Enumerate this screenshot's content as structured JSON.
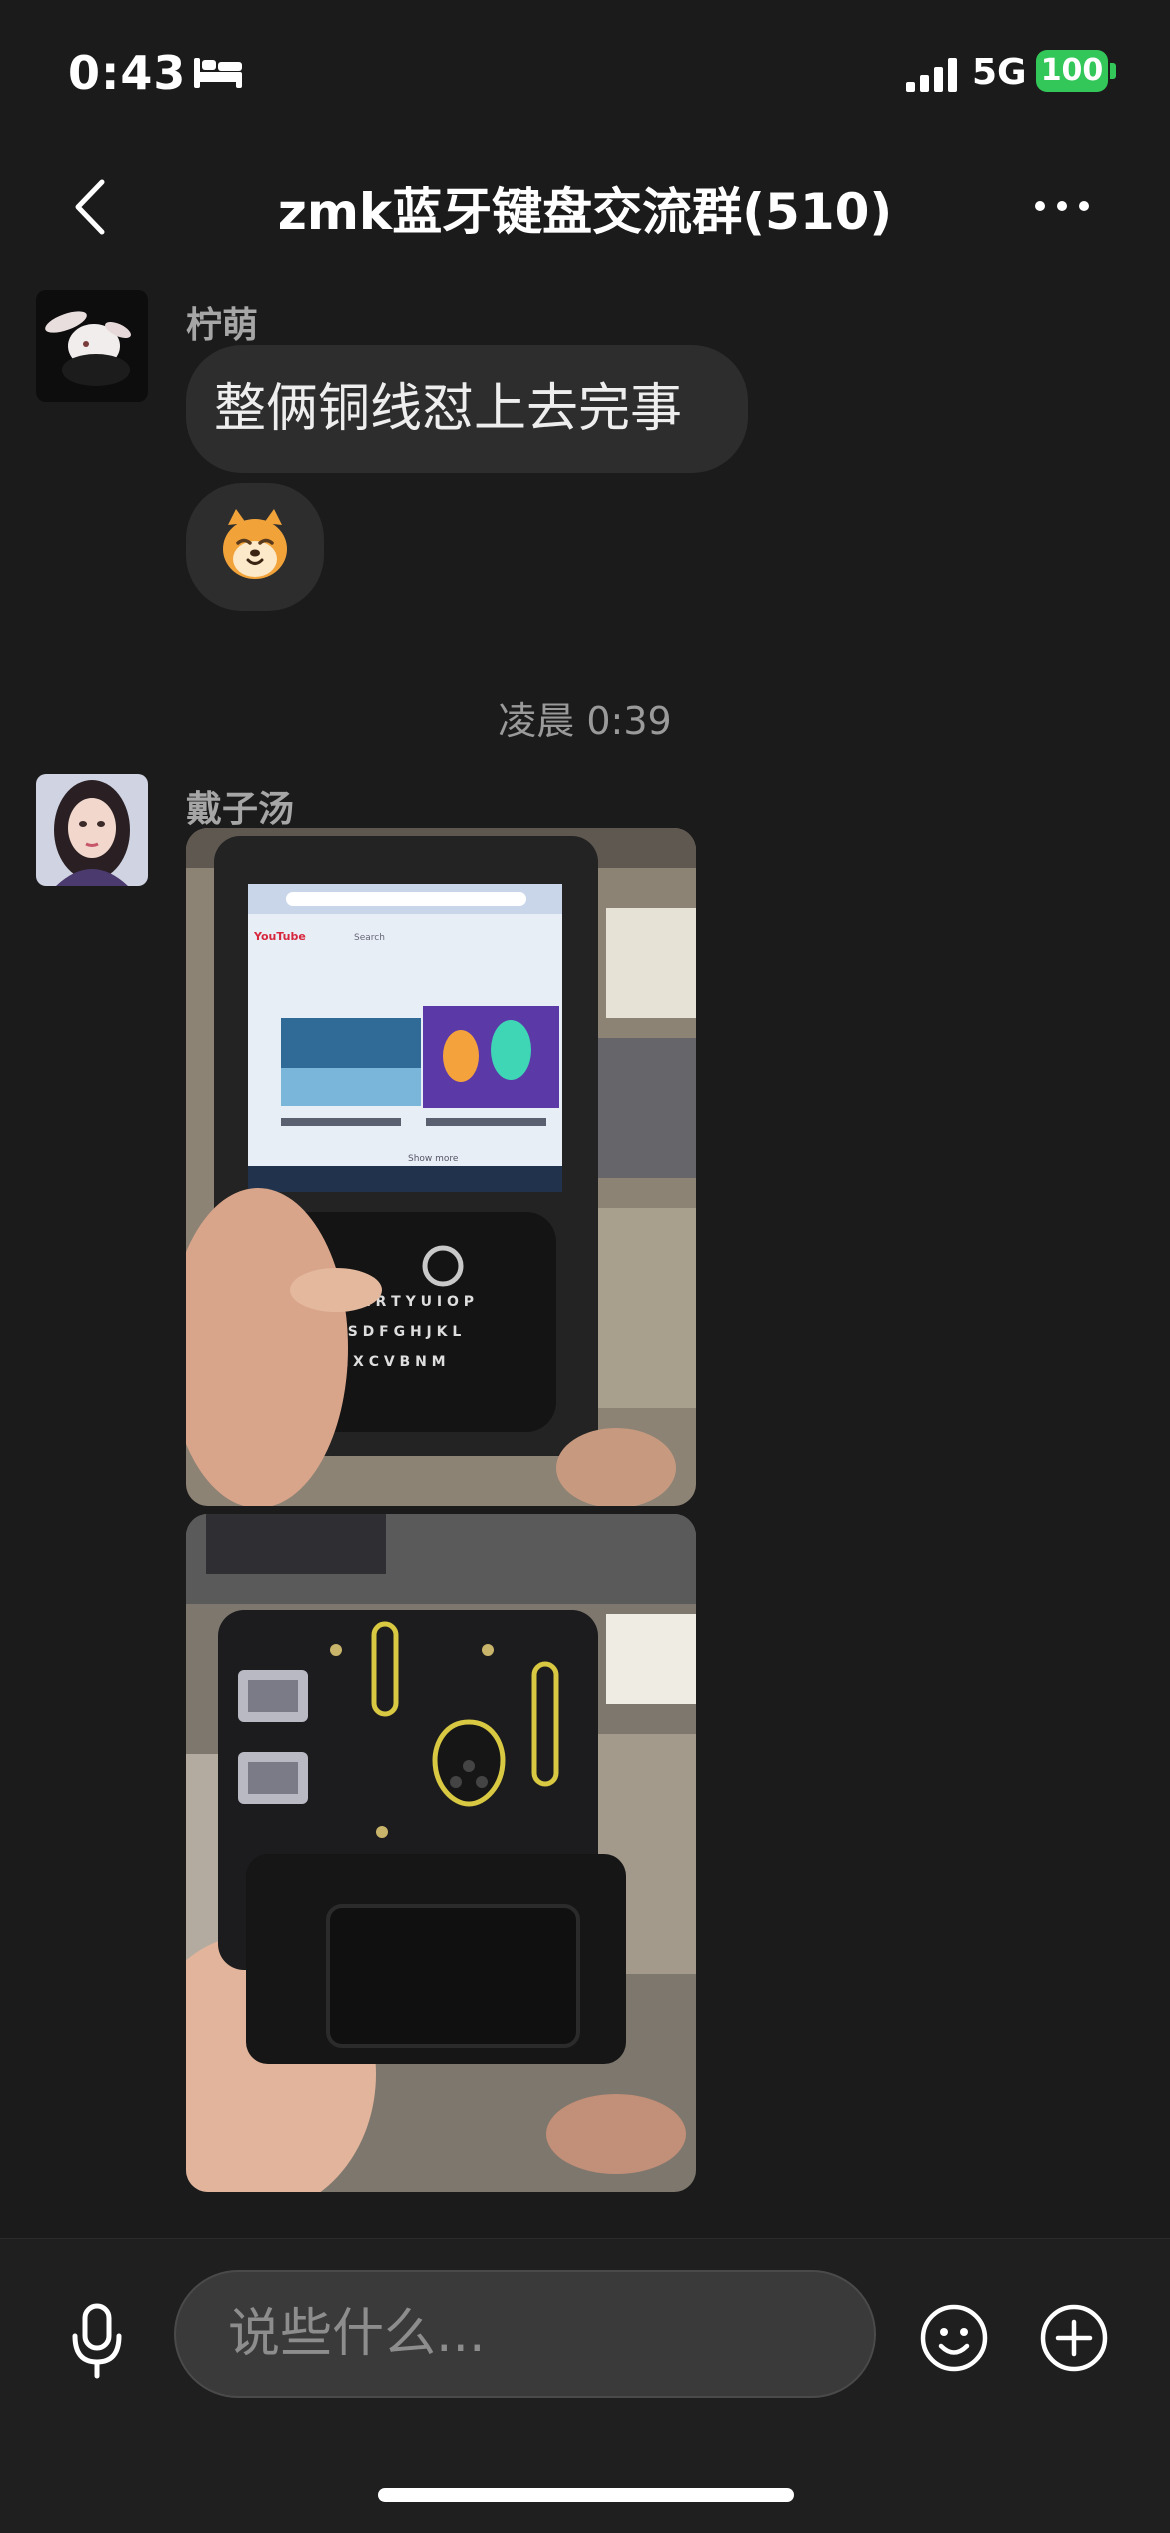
{
  "status_bar": {
    "time": "0:43",
    "network": "5G",
    "battery": "100"
  },
  "nav": {
    "title": "zmk蓝牙键盘交流群(510)"
  },
  "messages": [
    {
      "sender": "柠萌",
      "text": "整俩铜线怼上去完事"
    },
    {
      "sender": "戴子汤"
    }
  ],
  "timestamp": "凌晨 0:39",
  "photo1_screen": {
    "search": "Search",
    "brand": "YouTube",
    "show_more": "Show more"
  },
  "input": {
    "placeholder": "说些什么..."
  },
  "colors": {
    "background": "#1b1b1b",
    "bubble": "#2d2d2d",
    "battery": "#33c759",
    "input": "#3a3a3a"
  }
}
